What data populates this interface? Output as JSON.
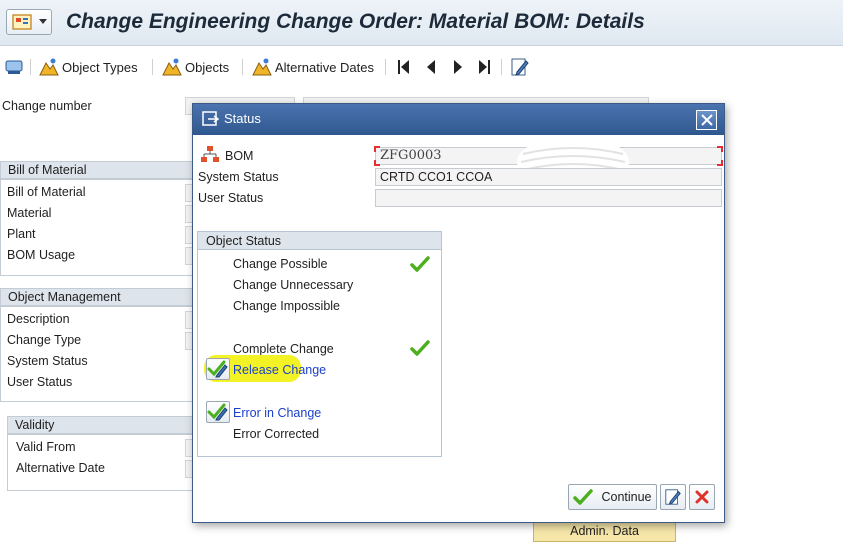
{
  "title": "Change Engineering Change Order: Material BOM: Details",
  "toolbar": {
    "items": [
      {
        "label": "",
        "icon": "display-icon"
      },
      {
        "label": "Object Types",
        "icon": "object-types-icon"
      },
      {
        "label": "Objects",
        "icon": "objects-icon"
      },
      {
        "label": "Alternative Dates",
        "icon": "alternative-dates-icon"
      }
    ],
    "nav": [
      "first-page-icon",
      "previous-page-icon",
      "next-page-icon",
      "last-page-icon",
      "edit-icon"
    ]
  },
  "background": {
    "change_number_label": "Change number",
    "bill_of_material_header": "Bill of Material",
    "bom_fields": [
      "Bill of Material",
      "Material",
      "Plant",
      "BOM Usage"
    ],
    "object_management_header": "Object Management",
    "om_fields": [
      "Description",
      "Change Type",
      "System Status",
      "User Status"
    ],
    "validity_header": "Validity",
    "validity_fields": [
      "Valid From",
      "Alternative Date"
    ],
    "admin_button": "Admin. Data"
  },
  "dialog": {
    "title": "Status",
    "bom_label": "BOM",
    "bom_value": "ZFG0003",
    "system_status_label": "System Status",
    "system_status_value": "CRTD CCO1 CCOA",
    "user_status_label": "User Status",
    "user_status_value": "",
    "object_status_header": "Object Status",
    "items": {
      "change_possible": "Change Possible",
      "change_unnecessary": "Change Unnecessary",
      "change_impossible": "Change Impossible",
      "complete_change": "Complete Change",
      "release_change": "Release Change",
      "error_in_change": "Error in Change",
      "error_corrected": "Error Corrected"
    },
    "checked": [
      "change_possible",
      "complete_change"
    ],
    "continue_label": "Continue",
    "colors": {
      "title_bar": "#3a64a0",
      "highlight": "#f3f225",
      "link": "#1a3fc9",
      "check": "#4caf1e"
    }
  }
}
